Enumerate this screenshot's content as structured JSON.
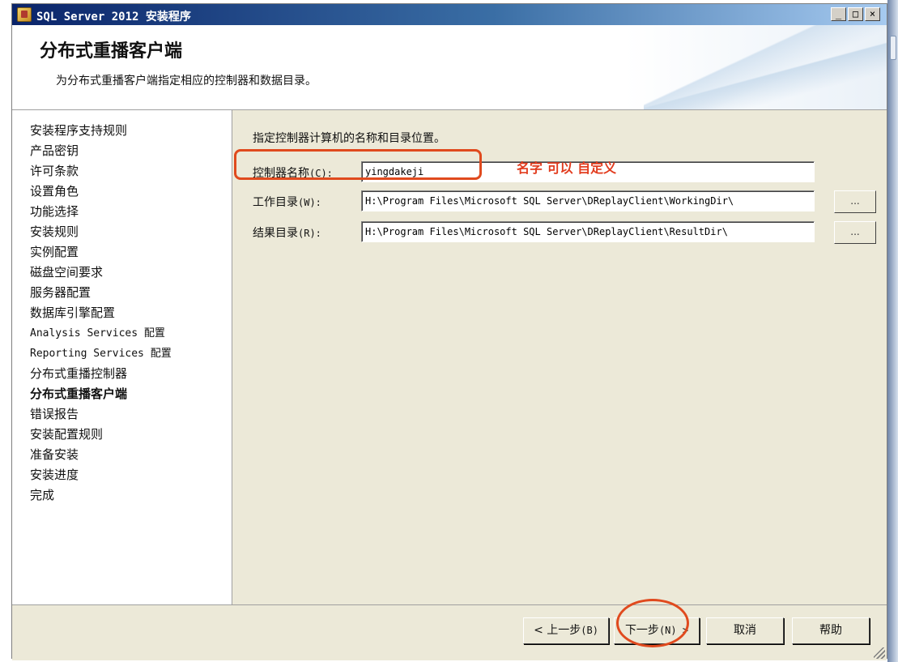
{
  "window": {
    "title": "SQL Server 2012 安装程序",
    "controls": {
      "minimize": "_",
      "maximize": "□",
      "close": "×"
    }
  },
  "header": {
    "title": "分布式重播客户端",
    "description": "为分布式重播客户端指定相应的控制器和数据目录。"
  },
  "nav": {
    "items": [
      {
        "label": "安装程序支持规则"
      },
      {
        "label": "产品密钥"
      },
      {
        "label": "许可条款"
      },
      {
        "label": "设置角色"
      },
      {
        "label": "功能选择"
      },
      {
        "label": "安装规则"
      },
      {
        "label": "实例配置"
      },
      {
        "label": "磁盘空间要求"
      },
      {
        "label": "服务器配置"
      },
      {
        "label": "数据库引擎配置"
      },
      {
        "label": "Analysis Services 配置"
      },
      {
        "label": "Reporting Services 配置"
      },
      {
        "label": "分布式重播控制器"
      },
      {
        "label": "分布式重播客户端",
        "active": true
      },
      {
        "label": "错误报告"
      },
      {
        "label": "安装配置规则"
      },
      {
        "label": "准备安装"
      },
      {
        "label": "安装进度"
      },
      {
        "label": "完成"
      }
    ]
  },
  "content": {
    "intro": "指定控制器计算机的名称和目录位置。",
    "controller": {
      "label": "控制器名称",
      "accel": "(C):",
      "value": "yingdakeji"
    },
    "working_dir": {
      "label": "工作目录",
      "accel": "(W):",
      "value": "H:\\Program Files\\Microsoft SQL Server\\DReplayClient\\WorkingDir\\",
      "browse": "..."
    },
    "result_dir": {
      "label": "结果目录",
      "accel": "(R):",
      "value": "H:\\Program Files\\Microsoft SQL Server\\DReplayClient\\ResultDir\\",
      "browse": "..."
    }
  },
  "annotation": {
    "text": "名字 可以 自定义",
    "color": "#e23c1e"
  },
  "footer": {
    "back": {
      "label": "< 上一步",
      "accel": "(B)"
    },
    "next": {
      "label": "下一步",
      "accel": "(N) >"
    },
    "cancel": {
      "label": "取消"
    },
    "help": {
      "label": "帮助"
    }
  }
}
